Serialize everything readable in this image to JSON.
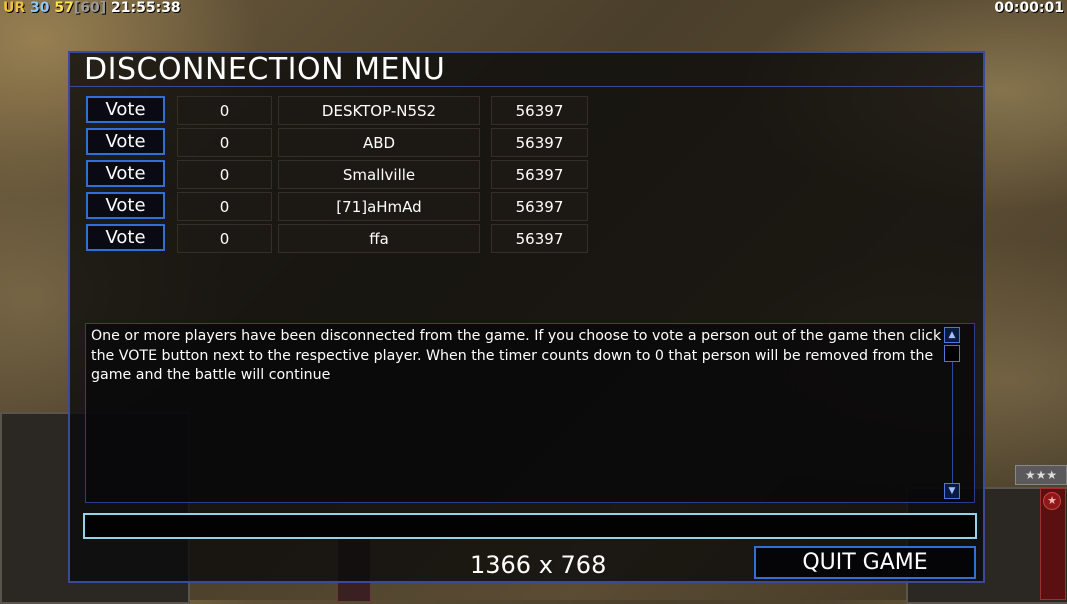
{
  "hud": {
    "ur_label": "UR",
    "fps": "30",
    "frame": "57",
    "frame_cap": "[60]",
    "clock": "21:55:38",
    "game_timer": "00:00:01"
  },
  "dialog": {
    "title": "DISCONNECTION MENU",
    "players": [
      {
        "vote_label": "Vote",
        "count": "0",
        "name": "DESKTOP-N5S2",
        "port": "56397"
      },
      {
        "vote_label": "Vote",
        "count": "0",
        "name": "ABD",
        "port": "56397"
      },
      {
        "vote_label": "Vote",
        "count": "0",
        "name": "Smallville",
        "port": "56397"
      },
      {
        "vote_label": "Vote",
        "count": "0",
        "name": "[71]aHmAd",
        "port": "56397"
      },
      {
        "vote_label": "Vote",
        "count": "0",
        "name": "ffa",
        "port": "56397"
      }
    ],
    "message": "One or more players have been disconnected from the game. If you choose to vote a person out of the game then click the VOTE button next to the respective player. When the timer counts down to 0 that person will be removed from the game and the battle will continue",
    "chat_value": "",
    "resolution": "1366 x 768",
    "quit_label": "QUIT GAME"
  },
  "decor": {
    "stars": "★★★",
    "rank_icon": "star-icon"
  },
  "colors": {
    "accent_border": "#2f6fd6",
    "dialog_border": "#3a4a9a",
    "chat_border": "#8fd4e8"
  }
}
